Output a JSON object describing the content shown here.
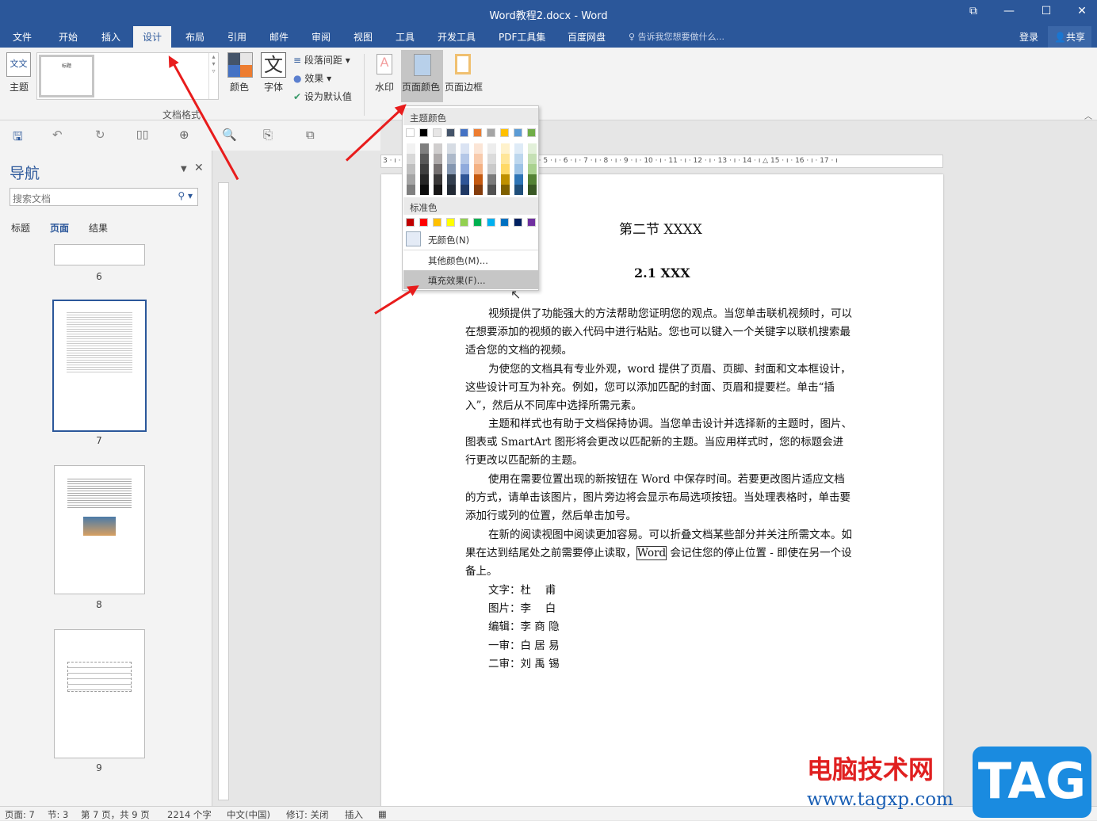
{
  "window": {
    "title": "Word教程2.docx - Word",
    "restore": "⧉",
    "minimize": "—",
    "maximize": "☐",
    "close": "✕"
  },
  "tabs": [
    "文件",
    "开始",
    "插入",
    "设计",
    "布局",
    "引用",
    "邮件",
    "审阅",
    "视图",
    "工具",
    "开发工具",
    "PDF工具集",
    "百度网盘"
  ],
  "active_tab": "设计",
  "tell_me": "告诉我您想要做什么...",
  "login": "登录",
  "share": "共享",
  "ribbon": {
    "theme": "主题",
    "style_thumb": "标题",
    "colors": "颜色",
    "fonts": "字体",
    "font_glyph": "文",
    "para_spacing": "段落间距",
    "effects": "效果",
    "set_default": "设为默认值",
    "group_label": "文档格式",
    "watermark": "水印",
    "page_color": "页面颜色",
    "page_border": "页面边框"
  },
  "nav": {
    "title": "导航",
    "search_placeholder": "搜索文档",
    "tabs": [
      "标题",
      "页面",
      "结果"
    ],
    "active": "页面",
    "pages": [
      "6",
      "7",
      "8",
      "9"
    ]
  },
  "menu": {
    "theme_colors_label": "主题颜色",
    "standard_label": "标准色",
    "no_color": "无颜色(N)",
    "more_colors": "其他颜色(M)...",
    "fill_effects": "填充效果(F)...",
    "theme_top": [
      "#ffffff",
      "#000000",
      "#e7e6e6",
      "#44546a",
      "#4472c4",
      "#ed7d31",
      "#a5a5a5",
      "#ffc000",
      "#5b9bd5",
      "#70ad47"
    ],
    "theme_shades": [
      [
        "#f2f2f2",
        "#d8d8d8",
        "#bfbfbf",
        "#a5a5a5",
        "#7f7f7f"
      ],
      [
        "#7f7f7f",
        "#595959",
        "#3f3f3f",
        "#262626",
        "#0c0c0c"
      ],
      [
        "#d0cece",
        "#aeaaaa",
        "#757070",
        "#3a3838",
        "#171616"
      ],
      [
        "#d6dce4",
        "#adb9ca",
        "#8496b0",
        "#333f4f",
        "#222a35"
      ],
      [
        "#dae3f3",
        "#b4c7e7",
        "#8faadc",
        "#2f5597",
        "#1f3864"
      ],
      [
        "#fbe5d6",
        "#f8cbad",
        "#f4b183",
        "#c55a11",
        "#843c0c"
      ],
      [
        "#ededed",
        "#dbdbdb",
        "#c9c9c9",
        "#7b7b7b",
        "#525252"
      ],
      [
        "#fff2cc",
        "#ffe699",
        "#ffd966",
        "#bf9000",
        "#7f6000"
      ],
      [
        "#deebf7",
        "#bdd7ee",
        "#9dc3e6",
        "#2e75b6",
        "#1f4e79"
      ],
      [
        "#e2f0d9",
        "#c5e0b4",
        "#a9d18e",
        "#548235",
        "#385723"
      ]
    ],
    "standard": [
      "#c00000",
      "#ff0000",
      "#ffc000",
      "#ffff00",
      "#92d050",
      "#00b050",
      "#00b0f0",
      "#0070c0",
      "#002060",
      "#7030a0"
    ]
  },
  "ruler": "3 · ı · 2 · ı · 1 · ı · ▯ · ı · 1 · ı · 2 · ı · 3 · ı · 4 · ı · 5 · ı · 6 · ı · 7 · ı · 8 · ı · 9 · ı · 10 · ı · 11 · ı · 12 · ı · 13 · ı · 14 · ı △ 15 · ı · 16 · ı · 17 · ı",
  "doc": {
    "heading": "第二节  XXXX",
    "subheading": "2.1 XXX",
    "paras": [
      "视频提供了功能强大的方法帮助您证明您的观点。当您单击联机视频时，可以在想要添加的视频的嵌入代码中进行粘贴。您也可以键入一个关键字以联机搜索最适合您的文档的视频。",
      "为使您的文档具有专业外观，word 提供了页眉、页脚、封面和文本框设计，这些设计可互为补充。例如，您可以添加匹配的封面、页眉和提要栏。单击“插入”，然后从不同库中选择所需元素。",
      "主题和样式也有助于文档保持协调。当您单击设计并选择新的主题时，图片、图表或 SmartArt 图形将会更改以匹配新的主题。当应用样式时，您的标题会进行更改以匹配新的主题。",
      "使用在需要位置出现的新按钮在 Word 中保存时间。若要更改图片适应文档的方式，请单击该图片，图片旁边将会显示布局选项按钮。当处理表格时，单击要添加行或列的位置，然后单击加号。"
    ],
    "last_para_a": "在新的阅读视图中阅读更加容易。可以折叠文档某些部分并关注所需文本。如果在达到结尾处之前需要停止读取，",
    "last_para_word": "Word",
    "last_para_b": " 会记住您的停止位置 - 即使在另一个设备上。",
    "credits": [
      [
        "文字：",
        "杜　 甫"
      ],
      [
        "图片：",
        "李　 白"
      ],
      [
        "编辑：",
        "李 商 隐"
      ],
      [
        "一审：",
        "白 居 易"
      ],
      [
        "二审：",
        "刘 禹 锡"
      ]
    ]
  },
  "status": {
    "page": "页面: 7",
    "section": "节: 3",
    "page_of": "第 7 页，共 9 页",
    "words": "2214 个字",
    "lang": "中文(中国)",
    "track": "修订: 关闭",
    "mode": "插入"
  },
  "watermark": {
    "text": "电脑技术网",
    "url": "www.tagxp.com",
    "tag": "TAG"
  }
}
